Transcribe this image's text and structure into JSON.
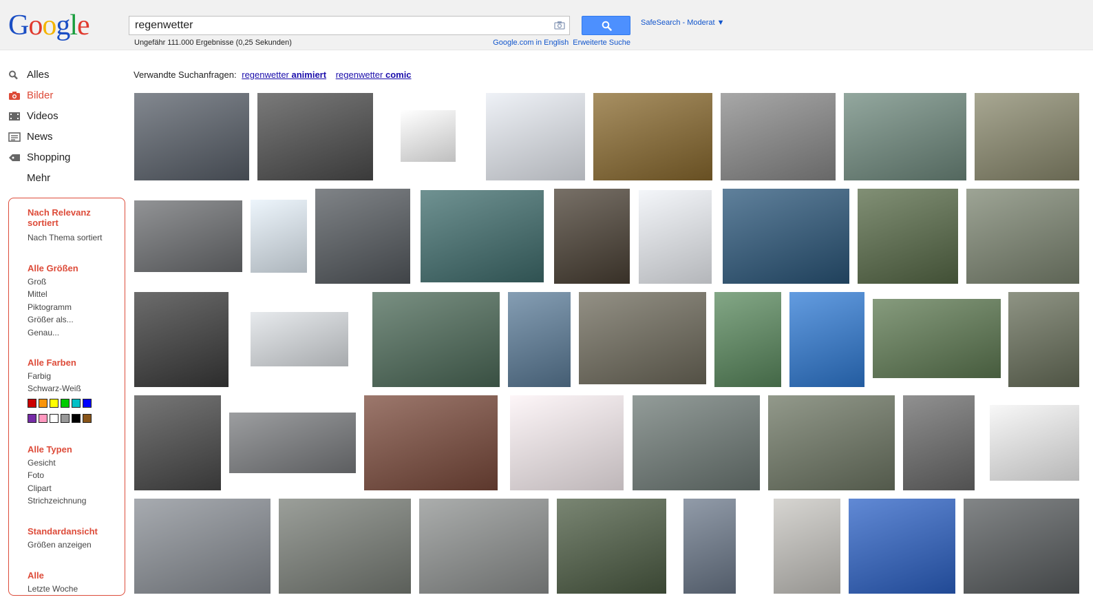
{
  "logo": {
    "letters": [
      "G",
      "o",
      "o",
      "g",
      "l",
      "e"
    ],
    "colors": [
      "#1a4ec4",
      "#e03a2e",
      "#f4b400",
      "#1a4ec4",
      "#179d3c",
      "#e03a2e"
    ]
  },
  "search": {
    "query": "regenwetter",
    "camera_icon": "camera-icon",
    "button_icon": "magnifier-icon"
  },
  "safesearch": "SafeSearch - Moderat ▼",
  "stats": "Ungefähr 111.000 Ergebnisse (0,25 Sekunden)",
  "toplinks": [
    "Google.com in English",
    "Erweiterte Suche"
  ],
  "nav": [
    {
      "label": "Alles",
      "icon": "search-icon",
      "active": false
    },
    {
      "label": "Bilder",
      "icon": "camera-icon",
      "active": true
    },
    {
      "label": "Videos",
      "icon": "film-icon",
      "active": false
    },
    {
      "label": "News",
      "icon": "newspaper-icon",
      "active": false
    },
    {
      "label": "Shopping",
      "icon": "tag-icon",
      "active": false
    },
    {
      "label": "Mehr",
      "icon": "",
      "active": false
    }
  ],
  "tools": {
    "sort": {
      "heading": "Nach Relevanz sortiert",
      "options": [
        "Nach Thema sortiert"
      ]
    },
    "size": {
      "heading": "Alle Größen",
      "options": [
        "Groß",
        "Mittel",
        "Piktogramm",
        "Größer als...",
        "Genau..."
      ]
    },
    "color": {
      "heading": "Alle Farben",
      "options": [
        "Farbig",
        "Schwarz-Weiß"
      ],
      "swatches": [
        "#cc0000",
        "#fb940b",
        "#ffff00",
        "#00cc00",
        "#03c0c6",
        "#0000ff",
        "#762ca7",
        "#ff98bf",
        "#ffffff",
        "#999999",
        "#000000",
        "#885418"
      ]
    },
    "type": {
      "heading": "Alle Typen",
      "options": [
        "Gesicht",
        "Foto",
        "Clipart",
        "Strichzeichnung"
      ]
    },
    "view": {
      "heading": "Standardansicht",
      "options": [
        "Größen anzeigen"
      ]
    },
    "time": {
      "heading": "Alle",
      "options": [
        "Letzte Woche"
      ]
    }
  },
  "related": {
    "label": "Verwandte Suchanfragen:",
    "items": [
      {
        "plain": "regenwetter ",
        "bold": "animiert"
      },
      {
        "plain": "regenwetter ",
        "bold": "comic"
      }
    ]
  },
  "images": [
    {
      "tone": "#59606a"
    },
    {
      "tone": "#4d4d4d"
    },
    {
      "tone": "#ffffff"
    },
    {
      "tone": "#e9edf4"
    },
    {
      "tone": "#8a6a2e"
    },
    {
      "tone": "#8a8a8a"
    },
    {
      "tone": "#6f8a7e"
    },
    {
      "tone": "#8b8a6e"
    },
    {
      "tone": "#6d6f72"
    },
    {
      "tone": "#e7f2fb"
    },
    {
      "tone": "#555a5f"
    },
    {
      "tone": "#3f6d6d"
    },
    {
      "tone": "#4a4034"
    },
    {
      "tone": "#f0f3f8"
    },
    {
      "tone": "#2a567a"
    },
    {
      "tone": "#576a47"
    },
    {
      "tone": "#7d8672"
    },
    {
      "tone": "#3b3b3b"
    },
    {
      "tone": "#dfe3e7"
    },
    {
      "tone": "#4c6a58"
    },
    {
      "tone": "#5c7d9a"
    },
    {
      "tone": "#6f6b5c"
    },
    {
      "tone": "#5a8a5e"
    },
    {
      "tone": "#2f7bd6"
    },
    {
      "tone": "#5e7a52"
    },
    {
      "tone": "#69705b"
    },
    {
      "tone": "#494949"
    },
    {
      "tone": "#7b7d80"
    },
    {
      "tone": "#7b4a3b"
    },
    {
      "tone": "#fdf3f6"
    },
    {
      "tone": "#6f7b77"
    },
    {
      "tone": "#6e7764"
    },
    {
      "tone": "#6b6b6b"
    },
    {
      "tone": "#f5f5f5"
    },
    {
      "tone": "#8a8f96"
    },
    {
      "tone": "#7a7f78"
    },
    {
      "tone": "#8f9291"
    },
    {
      "tone": "#4d5d44"
    },
    {
      "tone": "#6d7a8c"
    },
    {
      "tone": "#c9c7c2"
    },
    {
      "tone": "#2c62c7"
    },
    {
      "tone": "#595d5f"
    }
  ]
}
